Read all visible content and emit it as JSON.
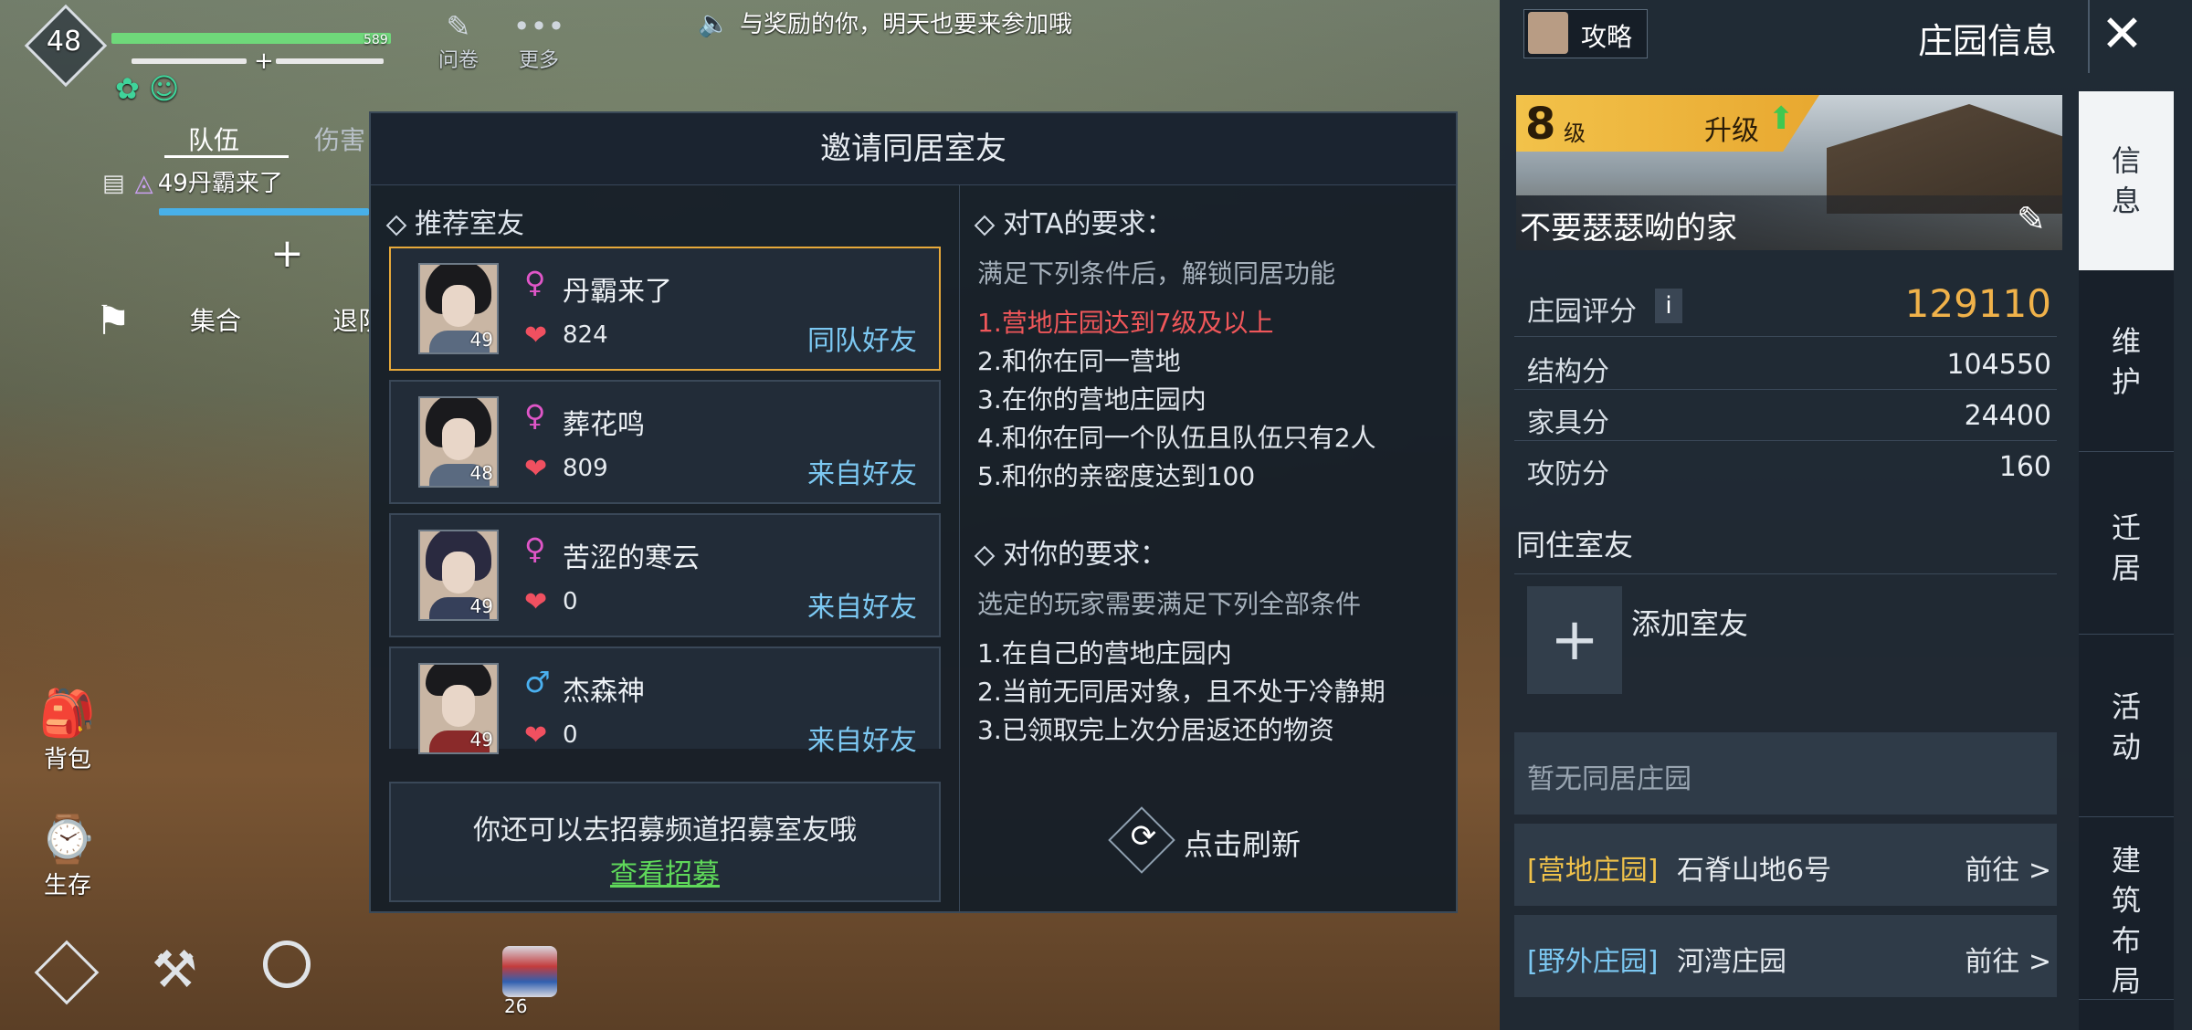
{
  "announcement": "与奖励的你，明天也要来参加哦",
  "hud": {
    "level": "48",
    "hp_value": "589",
    "hp_fill": 1.0,
    "top_buttons": [
      "问卷",
      "更多"
    ],
    "tabs": [
      "队伍",
      "伤害"
    ],
    "team_member": "49丹霸来了",
    "actions": [
      "集合",
      "退队"
    ],
    "left_buttons": [
      "背包",
      "生存"
    ],
    "item_count": "26"
  },
  "modal": {
    "title": "邀请同居室友",
    "recommended_title": "推荐室友",
    "friends": [
      {
        "name": "丹霸来了",
        "gender": "♀",
        "level": "49",
        "intimacy": "824",
        "source": "同队好友",
        "selected": true
      },
      {
        "name": "葬花鸣",
        "gender": "♀",
        "level": "48",
        "intimacy": "809",
        "source": "来自好友",
        "selected": false
      },
      {
        "name": "苦涩的寒云",
        "gender": "♀",
        "level": "49",
        "intimacy": "0",
        "source": "来自好友",
        "selected": false
      },
      {
        "name": "杰森神",
        "gender": "♂",
        "level": "49",
        "intimacy": "0",
        "source": "来自好友",
        "selected": false
      }
    ],
    "recruit_text": "你还可以去招募频道招募室友哦",
    "recruit_link": "查看招募",
    "req_ta_title": "对TA的要求：",
    "req_ta_subtitle": "满足下列条件后，解锁同居功能",
    "req_ta_items": [
      "1.营地庄园达到7级及以上",
      "2.和你在同一营地",
      "3.在你的营地庄园内",
      "4.和你在同一个队伍且队伍只有2人",
      "5.和你的亲密度达到100"
    ],
    "req_you_title": "对你的要求：",
    "req_you_subtitle": "选定的玩家需要满足下列全部条件",
    "req_you_items": [
      "1.在自己的营地庄园内",
      "2.当前无同居对象，且不处于冷静期",
      "3.已领取完上次分居返还的物资"
    ],
    "refresh_label": "点击刷新"
  },
  "panel": {
    "guide_label": "攻略",
    "title": "庄园信息",
    "level": "8",
    "level_unit": "级",
    "upgrade_label": "升级",
    "estate_name": "不要瑟瑟呦的家",
    "score_label": "庄园评分",
    "score_value": "129110",
    "stats": [
      {
        "label": "结构分",
        "value": "104550"
      },
      {
        "label": "家具分",
        "value": "24400"
      },
      {
        "label": "攻防分",
        "value": "160"
      }
    ],
    "roommates_title": "同住室友",
    "add_roommate": "添加室友",
    "no_cohabit": "暂无同居庄园",
    "estates": [
      {
        "tag": "[营地庄园]",
        "name": "石脊山地6号",
        "go": "前往 >"
      },
      {
        "tag": "[野外庄园]",
        "name": "河湾庄园",
        "go": "前往 >"
      }
    ],
    "side_tabs": [
      "信息",
      "维护",
      "迁居",
      "活动",
      "建筑布局"
    ]
  },
  "colors": {
    "accent_gold": "#f0b24a",
    "link_blue": "#7cc8f2",
    "requirement_red": "#f0575a",
    "link_green": "#5fd85a"
  }
}
